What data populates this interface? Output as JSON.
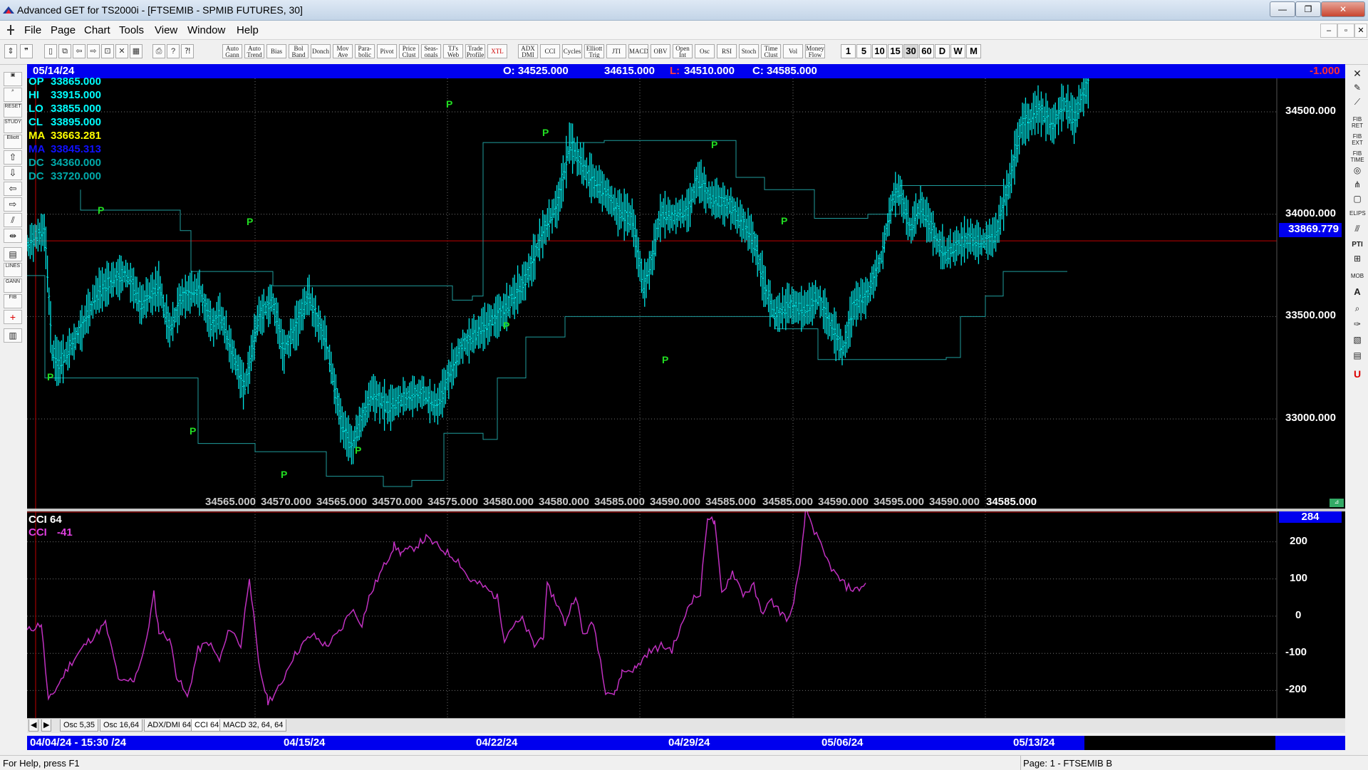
{
  "window": {
    "title": "Advanced GET for TS2000i - [FTSEMIB - SPMIB FUTURES, 30]"
  },
  "menu": {
    "items": [
      "File",
      "Page",
      "Chart",
      "Tools",
      "View",
      "Window",
      "Help"
    ]
  },
  "toolbar": {
    "study_buttons": [
      {
        "top": "Auto",
        "bottom": "Gann"
      },
      {
        "top": "Auto",
        "bottom": "Trend"
      },
      {
        "top": "Bias",
        "bottom": ""
      },
      {
        "top": "Bol",
        "bottom": "Band"
      },
      {
        "top": "Donch",
        "bottom": ""
      },
      {
        "top": "Mov",
        "bottom": "Ave"
      },
      {
        "top": "Para-",
        "bottom": "bolic"
      },
      {
        "top": "Pivot",
        "bottom": ""
      },
      {
        "top": "Price",
        "bottom": "Clust"
      },
      {
        "top": "Seas-",
        "bottom": "onals"
      },
      {
        "top": "TJ's",
        "bottom": "Web"
      },
      {
        "top": "Trade",
        "bottom": "Profile"
      },
      {
        "top": "XTL",
        "bottom": ""
      },
      {
        "top": "ADX",
        "bottom": "DMI"
      },
      {
        "top": "CCI",
        "bottom": ""
      },
      {
        "top": "Cycles",
        "bottom": ""
      },
      {
        "top": "Elliott",
        "bottom": "Trig"
      },
      {
        "top": "JTI",
        "bottom": ""
      },
      {
        "top": "MACD",
        "bottom": ""
      },
      {
        "top": "OBV",
        "bottom": ""
      },
      {
        "top": "Open",
        "bottom": "Int"
      },
      {
        "top": "Osc",
        "bottom": ""
      },
      {
        "top": "RSI",
        "bottom": ""
      },
      {
        "top": "Stoch",
        "bottom": ""
      },
      {
        "top": "Time",
        "bottom": "Clust"
      },
      {
        "top": "Vol",
        "bottom": ""
      },
      {
        "top": "Money",
        "bottom": "Flow"
      }
    ],
    "periods": [
      "1",
      "5",
      "10",
      "15",
      "30",
      "60",
      "D",
      "W",
      "M"
    ],
    "selected_period": "30"
  },
  "chart": {
    "date": "05/14/24",
    "ohlc": {
      "open": "O: 34525.000",
      "high": "34615.000",
      "low_label": "L:",
      "low": "34510.000",
      "close": "C: 34585.000"
    },
    "change": "-1.000",
    "legend": [
      {
        "label": "OP",
        "value": "33865.000",
        "color": "#00ffff"
      },
      {
        "label": "HI",
        "value": "33915.000",
        "color": "#00ffff"
      },
      {
        "label": "LO",
        "value": "33855.000",
        "color": "#00ffff"
      },
      {
        "label": "CL",
        "value": "33895.000",
        "color": "#00ffff"
      },
      {
        "label": "MA",
        "value": "33663.281",
        "color": "#ffff00"
      },
      {
        "label": "MA",
        "value": "33845.313",
        "color": "#1010ff"
      },
      {
        "label": "DC",
        "value": "34360.000",
        "color": "#00aaaa"
      },
      {
        "label": "DC",
        "value": "33720.000",
        "color": "#00aaaa"
      }
    ],
    "price_axis": [
      "34500.000",
      "34000.000",
      "33500.000",
      "33000.000"
    ],
    "current_price": "33869.779",
    "bottom_values": [
      "34565.000",
      "34570.000",
      "34565.000",
      "34570.000",
      "34575.000",
      "34580.000",
      "34580.000",
      "34585.000",
      "34590.000",
      "34585.000",
      "34585.000",
      "34590.000",
      "34595.000",
      "34590.000",
      "34585.000"
    ],
    "pivot_label": "P",
    "colors": {
      "price": "#00e5e5",
      "ma_slow": "#ffff33",
      "ma_fast": "#2020ff",
      "donchian": "#1f9c9c",
      "grid": "#707070",
      "cci": "#c030c0"
    }
  },
  "oscillator": {
    "title": "CCI 64",
    "label": "CCI",
    "value": "-41",
    "axis": [
      "200",
      "100",
      "0",
      "-100",
      "-200"
    ],
    "current": "284"
  },
  "tabs": [
    "Osc 5,35",
    "Osc 16,64",
    "ADX/DMI 64",
    "CCI 64",
    "MACD 32, 64, 64"
  ],
  "time_axis": {
    "first": "04/04/24 - 15:30 /24",
    "labels": [
      "04/15/24",
      "04/22/24",
      "04/29/24",
      "05/06/24",
      "05/13/24"
    ]
  },
  "status": {
    "help": "For Help, press F1",
    "page": "Page: 1 - FTSEMIB B"
  }
}
